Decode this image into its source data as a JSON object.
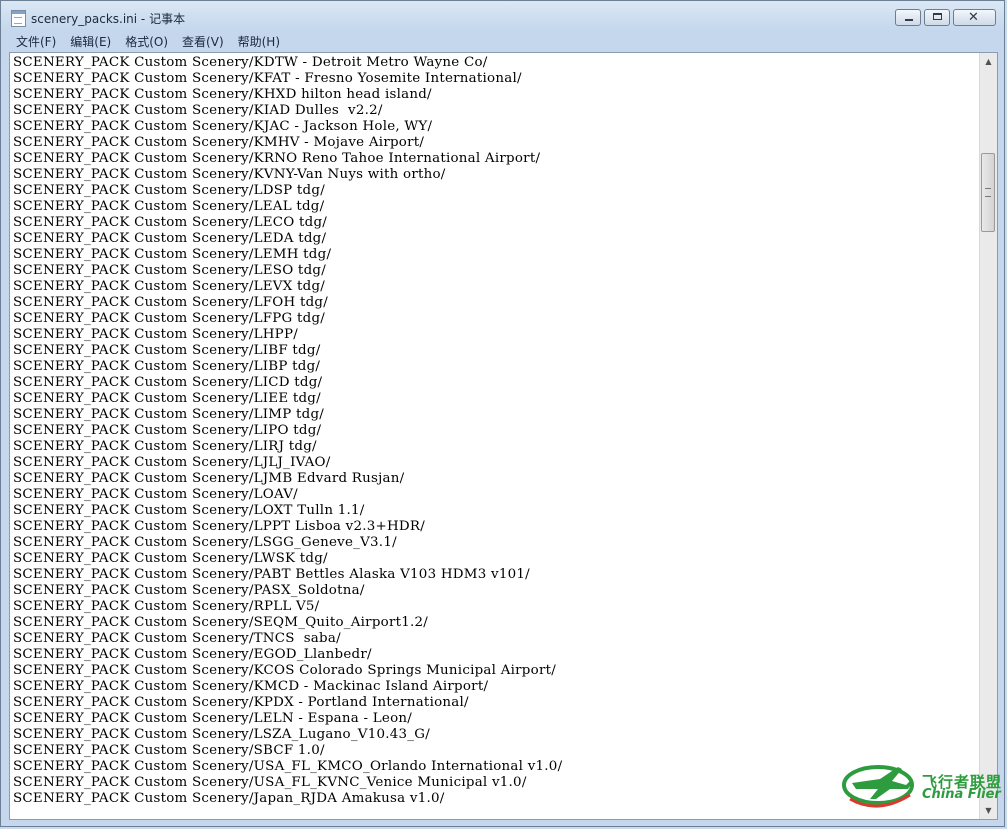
{
  "window": {
    "title": "scenery_packs.ini - 记事本",
    "minimize": "minimize",
    "maximize": "maximize",
    "close": "close"
  },
  "menu": [
    "文件(F)",
    "编辑(E)",
    "格式(O)",
    "查看(V)",
    "帮助(H)"
  ],
  "lines": [
    "SCENERY_PACK Custom Scenery/KDTW - Detroit Metro Wayne Co/",
    "SCENERY_PACK Custom Scenery/KFAT - Fresno Yosemite International/",
    "SCENERY_PACK Custom Scenery/KHXD hilton head island/",
    "SCENERY_PACK Custom Scenery/KIAD Dulles  v2.2/",
    "SCENERY_PACK Custom Scenery/KJAC - Jackson Hole, WY/",
    "SCENERY_PACK Custom Scenery/KMHV - Mojave Airport/",
    "SCENERY_PACK Custom Scenery/KRNO Reno Tahoe International Airport/",
    "SCENERY_PACK Custom Scenery/KVNY-Van Nuys with ortho/",
    "SCENERY_PACK Custom Scenery/LDSP tdg/",
    "SCENERY_PACK Custom Scenery/LEAL tdg/",
    "SCENERY_PACK Custom Scenery/LECO tdg/",
    "SCENERY_PACK Custom Scenery/LEDA tdg/",
    "SCENERY_PACK Custom Scenery/LEMH tdg/",
    "SCENERY_PACK Custom Scenery/LESO tdg/",
    "SCENERY_PACK Custom Scenery/LEVX tdg/",
    "SCENERY_PACK Custom Scenery/LFOH tdg/",
    "SCENERY_PACK Custom Scenery/LFPG tdg/",
    "SCENERY_PACK Custom Scenery/LHPP/",
    "SCENERY_PACK Custom Scenery/LIBF tdg/",
    "SCENERY_PACK Custom Scenery/LIBP tdg/",
    "SCENERY_PACK Custom Scenery/LICD tdg/",
    "SCENERY_PACK Custom Scenery/LIEE tdg/",
    "SCENERY_PACK Custom Scenery/LIMP tdg/",
    "SCENERY_PACK Custom Scenery/LIPO tdg/",
    "SCENERY_PACK Custom Scenery/LIRJ tdg/",
    "SCENERY_PACK Custom Scenery/LJLJ_IVAO/",
    "SCENERY_PACK Custom Scenery/LJMB Edvard Rusjan/",
    "SCENERY_PACK Custom Scenery/LOAV/",
    "SCENERY_PACK Custom Scenery/LOXT Tulln 1.1/",
    "SCENERY_PACK Custom Scenery/LPPT Lisboa v2.3+HDR/",
    "SCENERY_PACK Custom Scenery/LSGG_Geneve_V3.1/",
    "SCENERY_PACK Custom Scenery/LWSK tdg/",
    "SCENERY_PACK Custom Scenery/PABT Bettles Alaska V103 HDM3 v101/",
    "SCENERY_PACK Custom Scenery/PASX_Soldotna/",
    "SCENERY_PACK Custom Scenery/RPLL V5/",
    "SCENERY_PACK Custom Scenery/SEQM_Quito_Airport1.2/",
    "SCENERY_PACK Custom Scenery/TNCS  saba/",
    "SCENERY_PACK Custom Scenery/EGOD_Llanbedr/",
    "SCENERY_PACK Custom Scenery/KCOS Colorado Springs Municipal Airport/",
    "SCENERY_PACK Custom Scenery/KMCD - Mackinac Island Airport/",
    "SCENERY_PACK Custom Scenery/KPDX - Portland International/",
    "SCENERY_PACK Custom Scenery/LELN - Espana - Leon/",
    "SCENERY_PACK Custom Scenery/LSZA_Lugano_V10.43_G/",
    "SCENERY_PACK Custom Scenery/SBCF 1.0/",
    "SCENERY_PACK Custom Scenery/USA_FL_KMCO_Orlando International v1.0/",
    "SCENERY_PACK Custom Scenery/USA_FL_KVNC_Venice Municipal v1.0/",
    "SCENERY_PACK Custom Scenery/Japan_RJDA Amakusa v1.0/"
  ],
  "watermark": {
    "cn": "飞行者联盟",
    "en": "China Flier"
  },
  "colors": {
    "watermark_green": "#2c9c3e"
  }
}
